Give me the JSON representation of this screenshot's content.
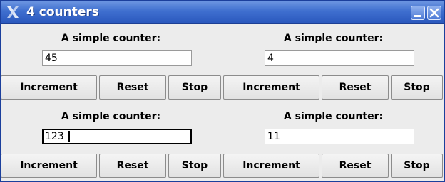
{
  "window": {
    "title": "4 counters",
    "minimize_icon": "minimize-icon",
    "close_icon": "close-icon",
    "app_icon": "x-logo-icon"
  },
  "counters": [
    {
      "label": "A simple counter:",
      "value": "45",
      "buttons": {
        "increment": "Increment",
        "reset": "Reset",
        "stop": "Stop"
      }
    },
    {
      "label": "A simple counter:",
      "value": "4",
      "buttons": {
        "increment": "Increment",
        "reset": "Reset",
        "stop": "Stop"
      }
    },
    {
      "label": "A simple counter:",
      "value": "123",
      "buttons": {
        "increment": "Increment",
        "reset": "Reset",
        "stop": "Stop"
      }
    },
    {
      "label": "A simple counter:",
      "value": "11",
      "buttons": {
        "increment": "Increment",
        "reset": "Reset",
        "stop": "Stop"
      }
    }
  ],
  "colors": {
    "titlebar": "#3f6fcf",
    "window_bg": "#ececec"
  }
}
